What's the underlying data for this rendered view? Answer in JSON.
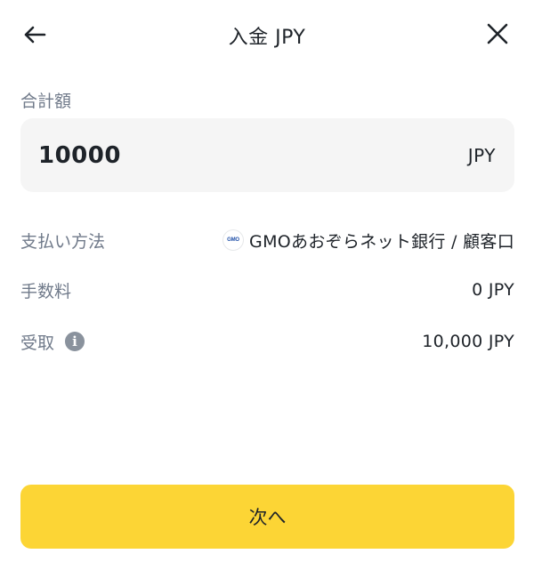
{
  "header": {
    "title": "入金 JPY",
    "back_icon": "arrow-left-icon",
    "close_icon": "close-icon"
  },
  "amount": {
    "label": "合計額",
    "value": "10000",
    "currency": "JPY"
  },
  "details": {
    "payment_method": {
      "label": "支払い方法",
      "bank_logo_text": "GMO",
      "value": "GMOあおぞらネット銀行 / 顧客口"
    },
    "fee": {
      "label": "手数料",
      "value": "0 JPY"
    },
    "receive": {
      "label": "受取",
      "info_icon": "info-icon",
      "value": "10,000 JPY"
    }
  },
  "footer": {
    "next_label": "次へ"
  },
  "colors": {
    "accent": "#fcd535",
    "label_gray": "#707a8a",
    "input_bg": "#f5f5f5",
    "text": "#1e2329"
  }
}
